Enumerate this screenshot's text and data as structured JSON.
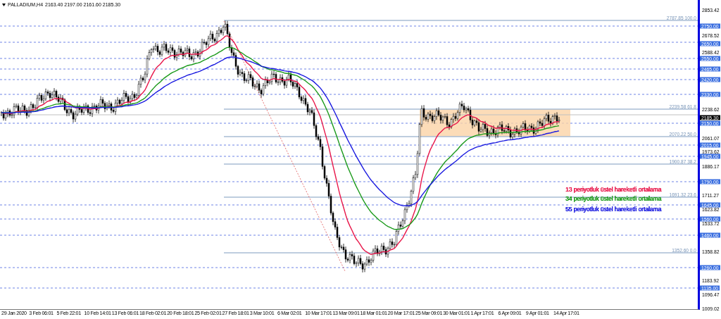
{
  "header": {
    "symbol": "PALLADIUM,H4",
    "ohlc": "2163.40 2197.00 2161.60 2185.30"
  },
  "fibonacci": [
    {
      "label": "2787.85 100.0"
    },
    {
      "label": "2239.58 61.8"
    },
    {
      "label": "2070.22 50.0"
    },
    {
      "label": "1900.87 38.2"
    },
    {
      "label": "1691.32 23.6"
    },
    {
      "label": "1352.60 0.0"
    }
  ],
  "legend": [
    {
      "text": "13 periyotluk üstel hareketli ortalama",
      "color": "#e8174a"
    },
    {
      "text": "34 periyotluk üstel hareketli ortalama",
      "color": "#1b9a1b"
    },
    {
      "text": "55 periyotluk üstel hareketli ortalama",
      "color": "#1a1ae0"
    }
  ],
  "price_axis": {
    "ticks": [
      "2853.42",
      "2678.52",
      "2588.42",
      "2238.62",
      "2061.07",
      "1973.62",
      "1886.17",
      "1711.27",
      "1623.82",
      "1533.72",
      "1358.82",
      "1183.92",
      "1096.47",
      "1009.02"
    ],
    "levels": [
      "2750.00",
      "2650.00",
      "2550.00",
      "2465.00",
      "2420.00",
      "2330.00",
      "2150.00",
      "2015.00",
      "1945.00",
      "1790.00",
      "1645.00",
      "1560.00",
      "1460.00",
      "1260.00",
      "1135.00"
    ],
    "current_price": "2185.30"
  },
  "time_axis": [
    "29 Jan 2020",
    "3 Feb 06:01",
    "5 Feb 22:01",
    "10 Feb 14:01",
    "13 Feb 06:01",
    "18 Feb 02:01",
    "20 Feb 18:01",
    "25 Feb 02:01",
    "27 Feb 18:01",
    "3 Mar 10:01",
    "6 Mar 02:01",
    "10 Mar 17:01",
    "13 Mar 09:01",
    "18 Mar 01:01",
    "20 Mar 17:01",
    "25 Mar 09:01",
    "30 Mar 01:01",
    "1 Apr 17:01",
    "6 Apr 09:01",
    "9 Apr 01:01",
    "14 Apr 17:01"
  ]
}
